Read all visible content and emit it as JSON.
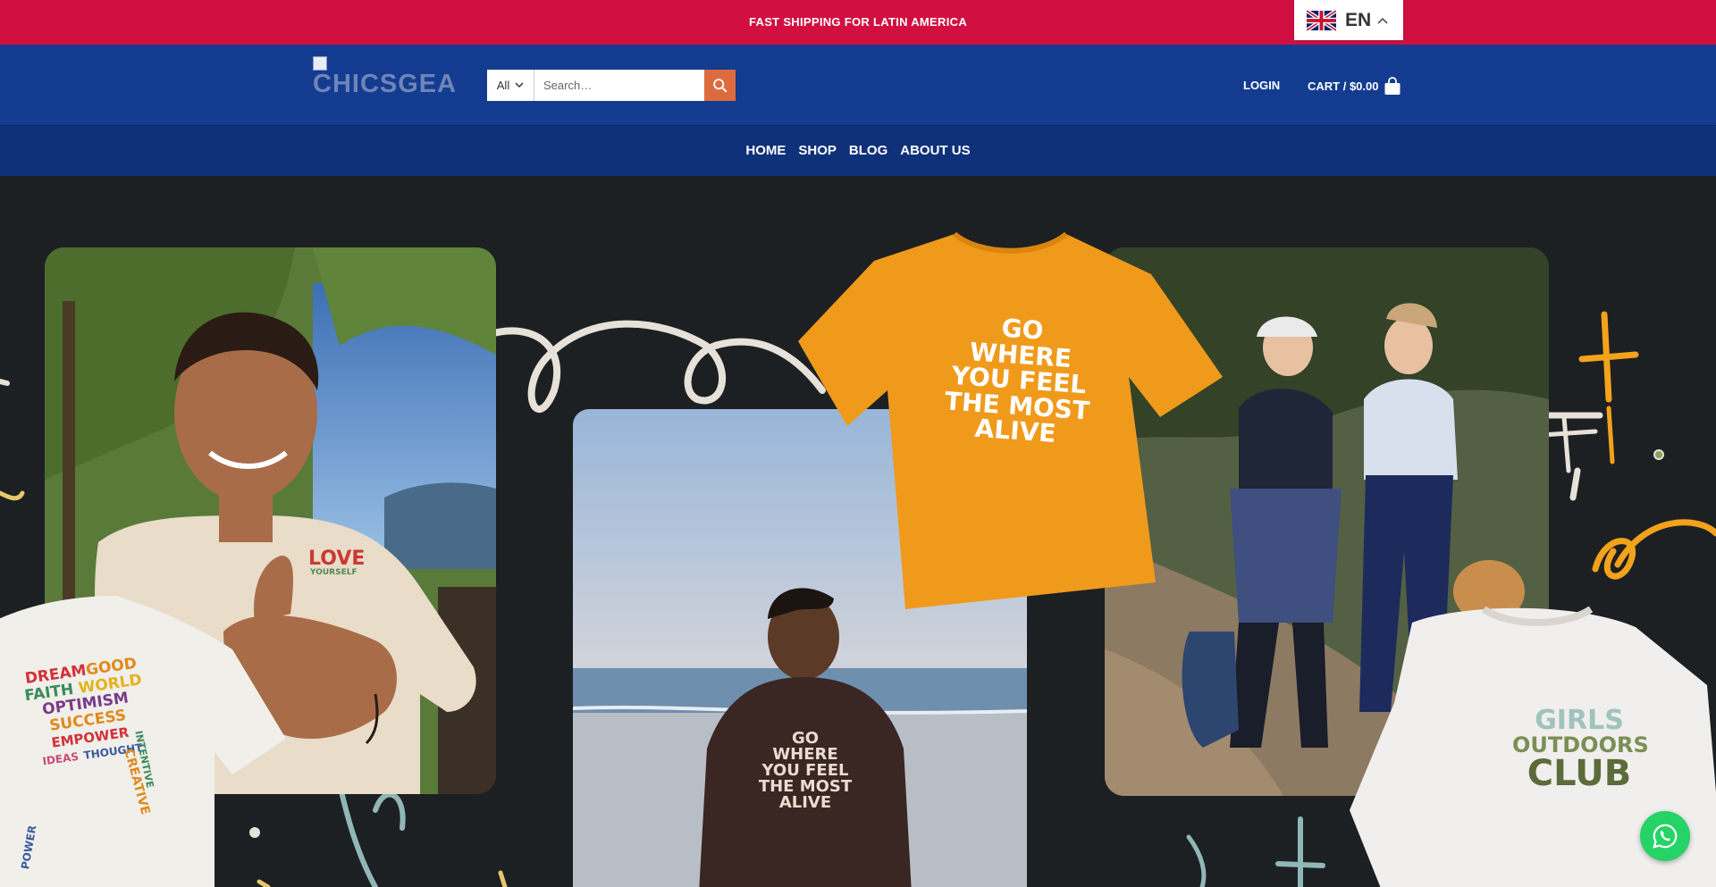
{
  "promo": {
    "text": "FAST SHIPPING FOR LATIN AMERICA"
  },
  "language": {
    "code": "EN",
    "flag": "uk-flag-icon"
  },
  "header": {
    "logo_text": "CHICSGEA",
    "search": {
      "category": "All",
      "placeholder": "Search…"
    },
    "login_label": "LOGIN",
    "cart_label": "CART / $0.00"
  },
  "nav": {
    "items": [
      "HOME",
      "SHOP",
      "BLOG",
      "ABOUT US"
    ]
  },
  "hero": {
    "orange_shirt_text": [
      "GO",
      "WHERE",
      "YOU FEEL",
      "THE MOST",
      "ALIVE"
    ],
    "hoodie_text": [
      "GO",
      "WHERE",
      "YOU FEEL",
      "THE MOST",
      "ALIVE"
    ],
    "left_shirt_text": "LOVE",
    "left_shirt_subtext": "YOURSELF",
    "white_shirt_words": [
      "DREAM",
      "GOOD",
      "FAITH",
      "WORLD",
      "OPTIMISM",
      "SUCCESS",
      "EMPOWER",
      "CREATIVE",
      "POWER",
      "IDEAS",
      "THOUGHT",
      "INTENTIVE"
    ],
    "sweat_text": [
      "GIRLS",
      "OUTDOORS",
      "CLUB"
    ]
  },
  "colors": {
    "promo_bar": "#d20f41",
    "header": "#133c91",
    "nav": "#0f3179",
    "search_button": "#dd6b3e",
    "hero_bg": "#1d2023",
    "whatsapp": "#25d366"
  }
}
